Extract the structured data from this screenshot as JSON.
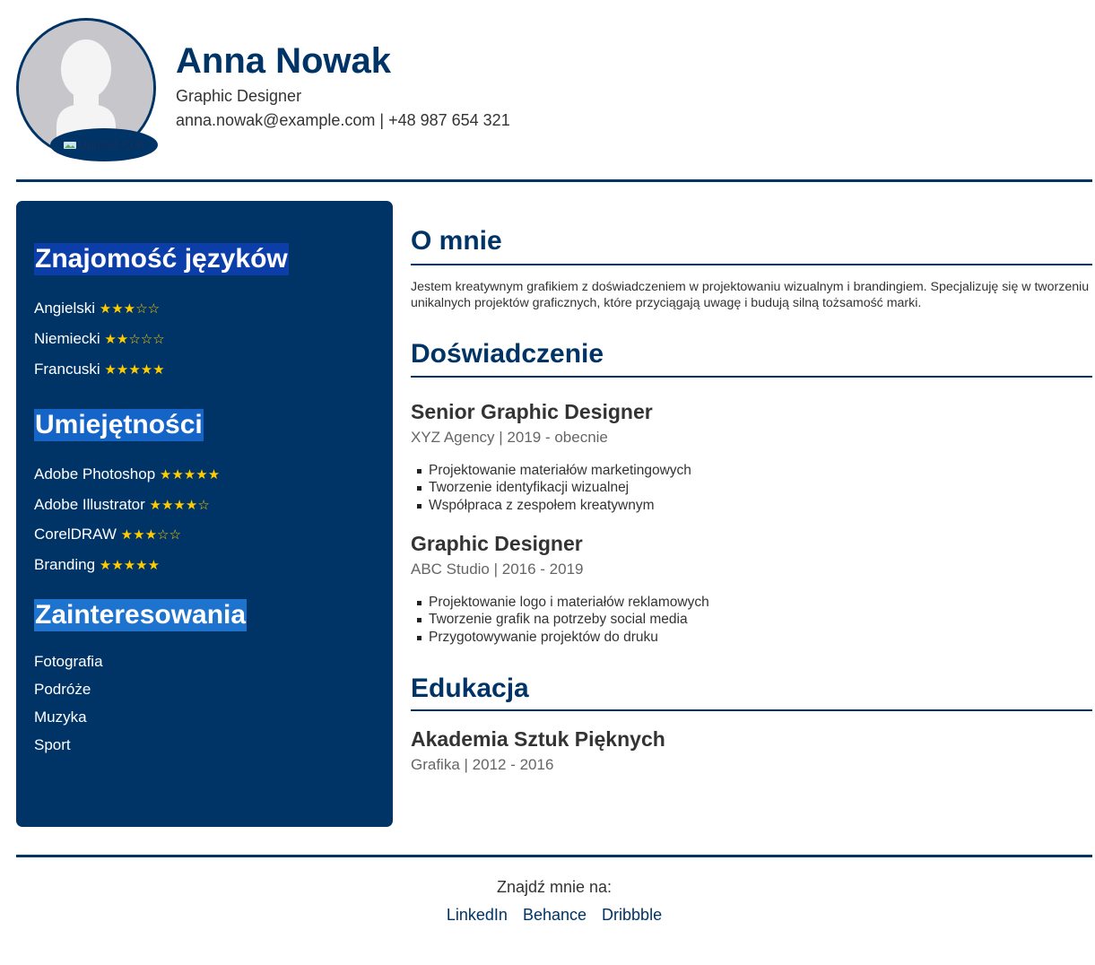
{
  "header": {
    "name": "Anna Nowak",
    "title": "Graphic Designer",
    "contact": "anna.nowak@example.com | +48 987 654 321",
    "upload_label": "Upload icon"
  },
  "sidebar": {
    "languages": {
      "heading": "Znajomość języków",
      "items": [
        {
          "label": "Angielski",
          "stars": "★★★☆☆",
          "rating": 3
        },
        {
          "label": "Niemiecki",
          "stars": "★★☆☆☆",
          "rating": 2
        },
        {
          "label": "Francuski",
          "stars": "★★★★★",
          "rating": 5
        }
      ]
    },
    "skills": {
      "heading": "Umiejętności",
      "items": [
        {
          "label": "Adobe Photoshop",
          "stars": "★★★★★",
          "rating": 5
        },
        {
          "label": "Adobe Illustrator",
          "stars": "★★★★☆",
          "rating": 4
        },
        {
          "label": "CorelDRAW",
          "stars": "★★★☆☆",
          "rating": 3
        },
        {
          "label": "Branding",
          "stars": "★★★★★",
          "rating": 5
        }
      ]
    },
    "interests": {
      "heading": "Zainteresowania",
      "items": [
        "Fotografia",
        "Podróże",
        "Muzyka",
        "Sport"
      ]
    }
  },
  "main": {
    "about": {
      "heading": "O mnie",
      "text": "Jestem kreatywnym grafikiem z doświadczeniem w projektowaniu wizualnym i brandingiem. Specjalizuję się w tworzeniu unikalnych projektów graficznych, które przyciągają uwagę i budują silną tożsamość marki."
    },
    "experience": {
      "heading": "Doświadczenie",
      "jobs": [
        {
          "title": "Senior Graphic Designer",
          "meta": "XYZ Agency | 2019 - obecnie",
          "bullets": [
            "Projektowanie materiałów marketingowych",
            "Tworzenie identyfikacji wizualnej",
            "Współpraca z zespołem kreatywnym"
          ]
        },
        {
          "title": "Graphic Designer",
          "meta": "ABC Studio | 2016 - 2019",
          "bullets": [
            "Projektowanie logo i materiałów reklamowych",
            "Tworzenie grafik na potrzeby social media",
            "Przygotowywanie projektów do druku"
          ]
        }
      ]
    },
    "education": {
      "heading": "Edukacja",
      "school": "Akademia Sztuk Pięknych",
      "meta": "Grafika | 2012 - 2016"
    }
  },
  "footer": {
    "find_me": "Znajdź mnie na:",
    "links": [
      "LinkedIn",
      "Behance",
      "Dribbble"
    ]
  },
  "colors": {
    "primary": "#003366",
    "star": "#ffcc00",
    "text": "#333333",
    "muted": "#666666"
  }
}
